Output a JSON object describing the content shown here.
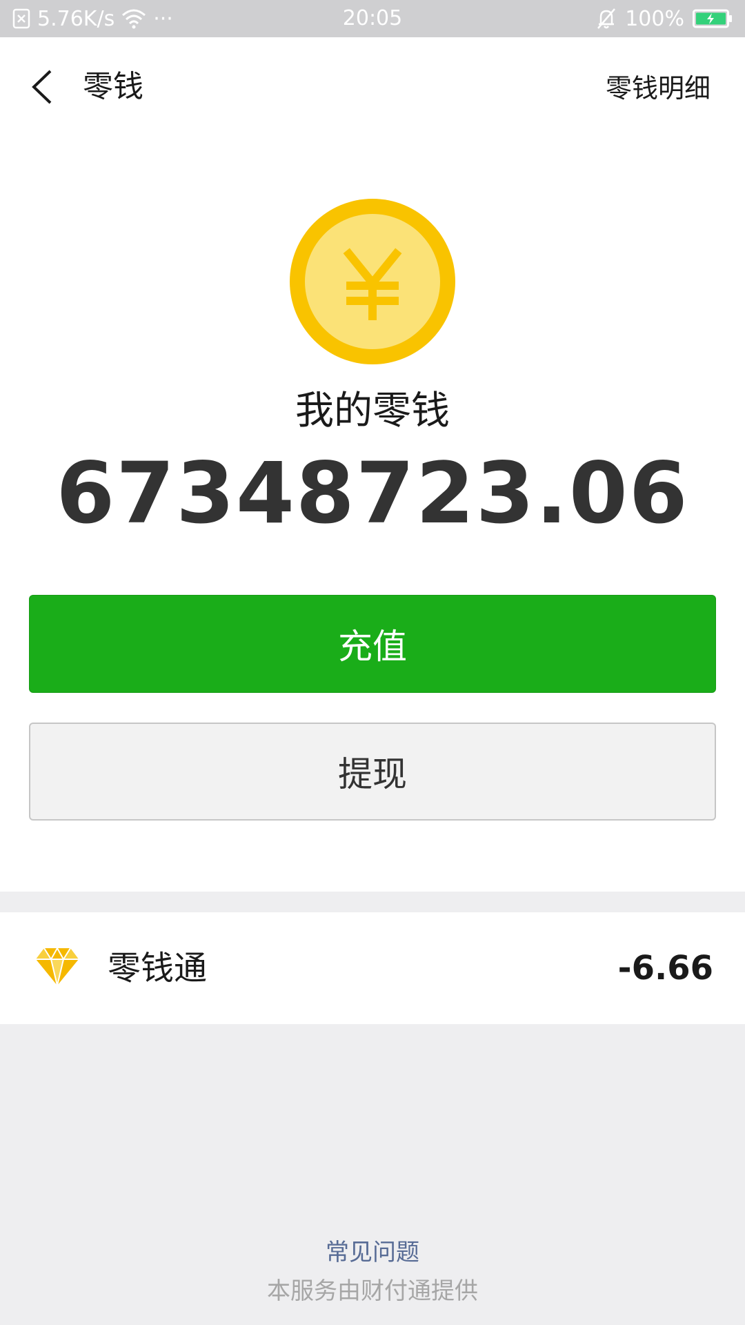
{
  "status_bar": {
    "network_speed": "5.76K/s",
    "dots": "···",
    "time": "20:05",
    "battery_percent": "100%",
    "icons": [
      "sim-off-icon",
      "wifi-icon",
      "bell-off-icon",
      "battery-charging-icon"
    ]
  },
  "nav": {
    "title": "零钱",
    "detail_link": "零钱明细",
    "back_icon": "back-chevron-icon"
  },
  "wallet": {
    "coin_icon": "yuan-coin-icon",
    "label": "我的零钱",
    "balance": "67348723.06",
    "coin_outer_color": "#F9C300",
    "coin_inner_color": "#FBE277"
  },
  "actions": {
    "recharge_label": "充值",
    "withdraw_label": "提现",
    "primary_color": "#1AAD19"
  },
  "lingqiantong": {
    "icon": "diamond-icon",
    "label": "零钱通",
    "value": "-6.66"
  },
  "footer": {
    "faq_label": "常见问题",
    "provider_text": "本服务由财付通提供",
    "link_color": "#576B95"
  }
}
